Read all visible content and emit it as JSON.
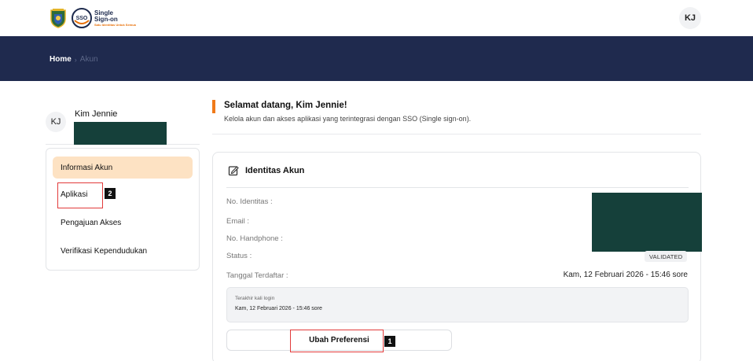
{
  "header": {
    "logo": {
      "crest_icon": "regional-crest-icon",
      "sso_badge": "SSO",
      "line1": "Single",
      "line2": "Sign-on",
      "tagline": "Satu Identitas Untuk Semua"
    },
    "avatar_initials": "KJ"
  },
  "breadcrumb": {
    "home": "Home",
    "separator": "›",
    "current": "Akun"
  },
  "user": {
    "initials": "KJ",
    "name": "Kim Jennie"
  },
  "sidebar": {
    "items": [
      {
        "label": "Informasi Akun",
        "active": true
      },
      {
        "label": "Aplikasi",
        "active": false
      },
      {
        "label": "Pengajuan Akses",
        "active": false
      },
      {
        "label": "Verifikasi Kependudukan",
        "active": false
      }
    ]
  },
  "welcome": {
    "title": "Selamat datang, Kim Jennie!",
    "subtitle": "Kelola akun dan akses aplikasi yang terintegrasi dengan SSO (Single sign-on)."
  },
  "identity": {
    "title": "Identitas Akun",
    "icon": "edit-document-icon",
    "fields": {
      "id_number": "No. Identitas :",
      "email": "Email :",
      "phone": "No. Handphone :",
      "status": "Status :",
      "registered": "Tanggal Terdaftar :"
    },
    "status_value": "VALIDATED",
    "registered_value": "Kam, 12 Februari 2026 - 15:46 sore",
    "last_login": {
      "label": "Terakhir kali login",
      "value": "Kam, 12 Februari 2026 - 15:46 sore"
    },
    "preference_button": "Ubah Preferensi"
  },
  "annotations": {
    "mark1": "1",
    "mark2": "2"
  },
  "colors": {
    "nav_band": "#1f2a4e",
    "accent_orange": "#f07a1a",
    "active_menu": "#fde2c3",
    "redaction": "#15403a",
    "annotation_box": "#e23b3b"
  }
}
